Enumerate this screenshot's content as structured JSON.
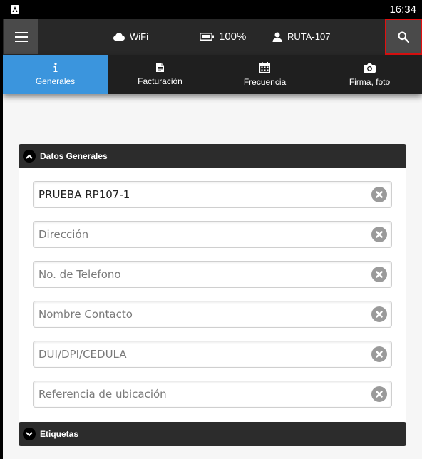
{
  "status_bar": {
    "time": "16:34",
    "app_icon": "app-icon"
  },
  "topbar": {
    "menu_icon": "hamburger-icon",
    "wifi": {
      "icon": "cloud-icon",
      "label": "WiFi"
    },
    "battery": {
      "icon": "battery-icon",
      "label": "100%"
    },
    "route": {
      "icon": "user-icon",
      "label": "RUTA-107"
    },
    "search_icon": "search-icon"
  },
  "tabs": [
    {
      "label": "Generales",
      "icon": "info-icon",
      "active": true
    },
    {
      "label": "Facturación",
      "icon": "document-icon",
      "active": false
    },
    {
      "label": "Frecuencia",
      "icon": "calendar-icon",
      "active": false
    },
    {
      "label": "Firma, foto",
      "icon": "camera-icon",
      "active": false
    }
  ],
  "panels": {
    "general": {
      "title": "Datos Generales",
      "expanded": true
    },
    "tags": {
      "title": "Etiquetas",
      "expanded": false
    }
  },
  "fields": [
    {
      "value": "PRUEBA RP107-1",
      "placeholder": ""
    },
    {
      "value": "",
      "placeholder": "Dirección"
    },
    {
      "value": "",
      "placeholder": "No. de Telefono"
    },
    {
      "value": "",
      "placeholder": "Nombre Contacto"
    },
    {
      "value": "",
      "placeholder": "DUI/DPI/CEDULA"
    },
    {
      "value": "",
      "placeholder": "Referencia de ubicación"
    }
  ],
  "colors": {
    "accent": "#3b95dd",
    "topbar": "#282828",
    "highlight_border": "#e01010",
    "panel_header": "#2c2c2c"
  }
}
